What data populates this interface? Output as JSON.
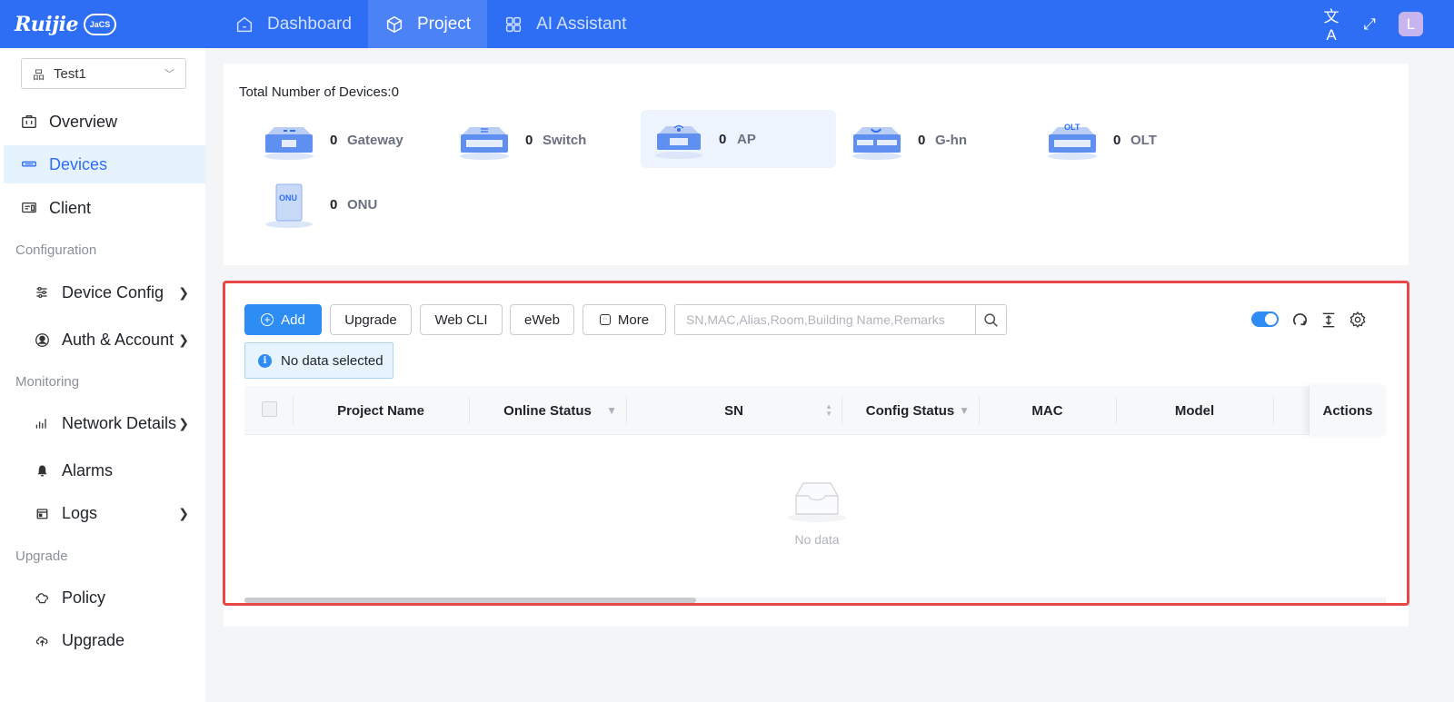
{
  "topbar": {
    "logo_text": "Ruijie",
    "logo_badge": "JaCS",
    "nav": [
      {
        "label": "Dashboard",
        "active": false,
        "icon": "home-icon"
      },
      {
        "label": "Project",
        "active": true,
        "icon": "cube-icon"
      },
      {
        "label": "AI Assistant",
        "active": false,
        "icon": "grid-icon"
      }
    ],
    "right_icons": [
      "translate-icon",
      "fullscreen-icon"
    ],
    "avatar_letter": "L"
  },
  "sidebar": {
    "project": "Test1",
    "items": [
      {
        "label": "Overview",
        "icon": "briefcase-icon"
      },
      {
        "label": "Devices",
        "icon": "devices-icon",
        "active": true
      },
      {
        "label": "Client",
        "icon": "client-icon"
      }
    ],
    "group_configuration": "Configuration",
    "config_items": [
      {
        "label": "Device Config",
        "icon": "sliders-icon",
        "has_children": true
      },
      {
        "label": "Auth & Account",
        "icon": "user-circle-icon",
        "has_children": true
      }
    ],
    "group_monitoring": "Monitoring",
    "monitor_items": [
      {
        "label": "Network Details",
        "icon": "bar-chart-icon",
        "has_children": true
      },
      {
        "label": "Alarms",
        "icon": "bell-icon",
        "has_children": false
      },
      {
        "label": "Logs",
        "icon": "calendar-icon",
        "has_children": true
      }
    ],
    "group_upgrade": "Upgrade",
    "upgrade_items": [
      {
        "label": "Policy",
        "icon": "policy-icon"
      },
      {
        "label": "Upgrade",
        "icon": "cloud-upload-icon"
      }
    ]
  },
  "summary": {
    "total_label": "Total Number of Devices:0",
    "devices": [
      {
        "count": "0",
        "name": "Gateway",
        "img_label": "",
        "highlight": false
      },
      {
        "count": "0",
        "name": "Switch",
        "img_label": "",
        "highlight": false
      },
      {
        "count": "0",
        "name": "AP",
        "img_label": "",
        "highlight": true
      },
      {
        "count": "0",
        "name": "G-hn",
        "img_label": "",
        "highlight": false
      },
      {
        "count": "0",
        "name": "OLT",
        "img_label": "OLT",
        "highlight": false
      },
      {
        "count": "0",
        "name": "ONU",
        "img_label": "ONU",
        "highlight": false
      }
    ]
  },
  "toolbar": {
    "add_label": "Add",
    "upgrade_label": "Upgrade",
    "webcli_label": "Web CLI",
    "eweb_label": "eWeb",
    "more_label": "More",
    "search_placeholder": "SN,MAC,Alias,Room,Building Name,Remarks"
  },
  "selection_alert": "No data selected",
  "table": {
    "columns": [
      "Project Name",
      "Online Status",
      "SN",
      "Config Status",
      "MAC",
      "Model",
      "Actions"
    ],
    "empty_text": "No data"
  }
}
